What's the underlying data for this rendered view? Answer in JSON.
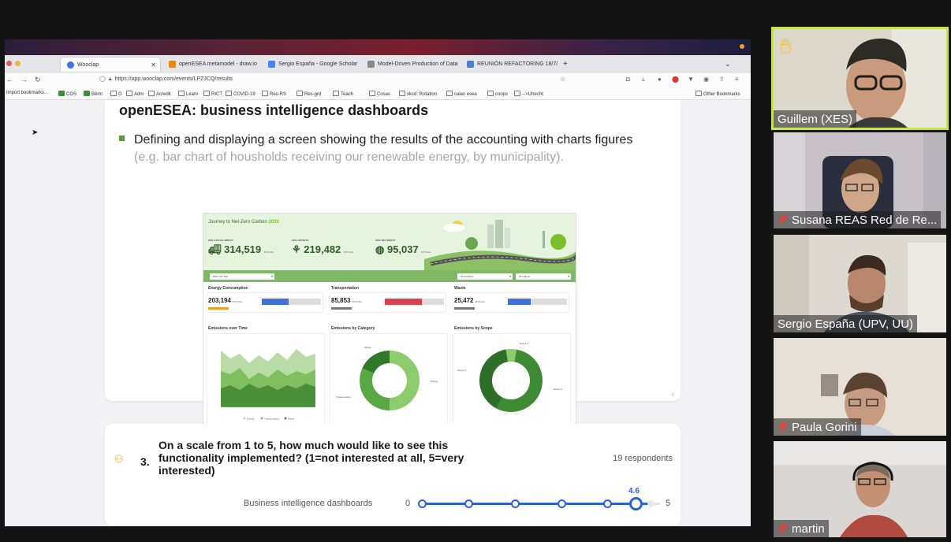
{
  "browser": {
    "tabs": [
      {
        "label": "Wooclap",
        "active": true
      },
      {
        "label": "openESEA metamodel - draw.io"
      },
      {
        "label": "Sergio España - Google Scholar"
      },
      {
        "label": "Model-Driven Production of Data"
      },
      {
        "label": "REUNIÓN REFACTORING 18/7/"
      }
    ],
    "new_tab": "+",
    "url": "https://app.wooclap.com/events/LPZJCQ/results",
    "bookmarks": [
      "Import bookmarks...",
      "COS",
      "Bêmr",
      "G",
      "Adm",
      "Acredit",
      "Learn",
      "RICT",
      "COVID-19",
      "Res-RS",
      "Res-grd",
      "Teach",
      "Cosas",
      "xkcd: Rotation",
      "calas esea",
      "coops",
      "-->Utrecht"
    ],
    "other_bookmarks": "Other Bookmarks"
  },
  "slide": {
    "title": "openESEA: business intelligence dashboards",
    "bullet": "Defining and displaying a screen showing the results of the accounting with charts figures",
    "bullet_sub": "(e.g. bar chart of housholds receiving our renewable energy, by municipality).",
    "page_num": "8"
  },
  "dashboard": {
    "hero_title": "Journey to Net-Zero Carbon",
    "hero_year": "2035",
    "kpis": [
      {
        "label": "2021 ACTUAL IMPACT",
        "value": "314,519",
        "unit": "MTCO2e"
      },
      {
        "label": "2021 OFFSETS",
        "value": "219,482",
        "unit": "MTCO2e"
      },
      {
        "label": "2021 NET IMPACT",
        "value": "95,037",
        "unit": "MTCO2e"
      }
    ],
    "filters": [
      "2021 Full Year",
      "All countries",
      "All regions"
    ],
    "metrics": [
      {
        "title": "Energy Consumption",
        "value": "203,194",
        "unit": "MTCO2e",
        "fill": 0.45,
        "color": "#3f6fd8",
        "tag_color": "#f0a020"
      },
      {
        "title": "Transportation",
        "value": "85,853",
        "unit": "MTCO2e",
        "fill": 0.62,
        "color": "#d94050",
        "tag_color": "#777777"
      },
      {
        "title": "Waste",
        "value": "25,472",
        "unit": "MTCO2e",
        "fill": 0.38,
        "color": "#3f6fd8",
        "tag_color": "#777777"
      }
    ],
    "charts": {
      "time_title": "Emissions over Time",
      "category_title": "Emissions by Category",
      "scope_title": "Emissions by Scope",
      "category_labels": [
        "Waste",
        "Energy",
        "Transportation"
      ],
      "scope_labels": [
        "Scope 1",
        "Scope 2",
        "Scope 3"
      ],
      "legend": [
        "Energy",
        "Transportation",
        "Waste"
      ]
    }
  },
  "question": {
    "number": "3.",
    "text": "On a scale from 1 to 5, how much would like to see this functionality implemented? (1=not interested at all, 5=very interested)",
    "respondents": "19 respondents",
    "scale_label": "Business intelligence dashboards",
    "min": "0",
    "max": "5",
    "value": "4.6",
    "value_fraction": 0.92
  },
  "participants": [
    {
      "name": "Guillem (XES)",
      "muted": false,
      "hand_raised": true,
      "active": true
    },
    {
      "name": "Susana REAS Red de Re...",
      "muted": true
    },
    {
      "name": "Sergio España (UPV, UU)",
      "muted": false
    },
    {
      "name": "Paula Gorini",
      "muted": true
    },
    {
      "name": "martin",
      "muted": true
    }
  ]
}
